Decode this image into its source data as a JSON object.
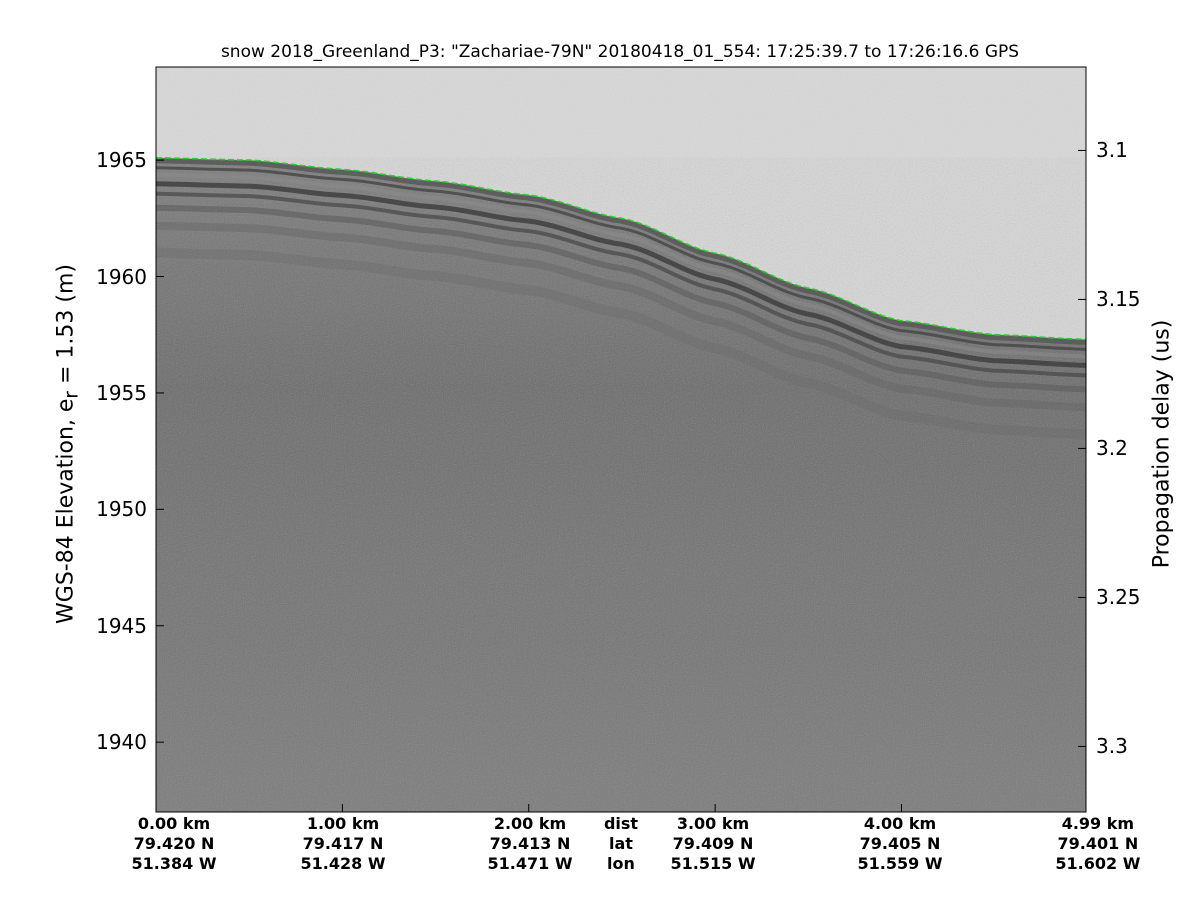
{
  "chart_data": {
    "type": "heatmap",
    "title": "snow 2018_Greenland_P3: \"Zachariae-79N\"  20180418_01_554: 17:25:39.7 to 17:26:16.6 GPS",
    "ylabel_left_prefix": "WGS-84 Elevation, e",
    "ylabel_left_sub": "r",
    "ylabel_left_suffix": " = 1.53 (m)",
    "ylabel_right": "Propagation delay (us)",
    "ylim_left": [
      1937,
      1969
    ],
    "ylim_right": [
      3.072,
      3.322
    ],
    "yticks_left": [
      "1940",
      "1945",
      "1950",
      "1955",
      "1960",
      "1965"
    ],
    "yticks_right": [
      "3.1",
      "3.15",
      "3.2",
      "3.25",
      "3.3"
    ],
    "x_columns": [
      {
        "dist": "0.00 km",
        "lat": "79.420 N",
        "lon": "51.384 W"
      },
      {
        "dist": "1.00 km",
        "lat": "79.417 N",
        "lon": "51.428 W"
      },
      {
        "dist": "2.00 km",
        "lat": "79.413 N",
        "lon": "51.471 W"
      },
      {
        "dist": "3.00 km",
        "lat": "79.409 N",
        "lon": "51.515 W"
      },
      {
        "dist": "4.00 km",
        "lat": "79.405 N",
        "lon": "51.559 W"
      },
      {
        "dist": "4.99 km",
        "lat": "79.401 N",
        "lon": "51.602 W"
      }
    ],
    "x_row_names": {
      "dist": "dist",
      "lat": "lat",
      "lon": "lon"
    },
    "x_distances_km": [
      0,
      1,
      2,
      3,
      4,
      4.99
    ],
    "xlim_km": [
      0,
      4.99
    ],
    "surface_series": {
      "name": "",
      "x_km": [
        0,
        0.5,
        1.0,
        1.5,
        2.0,
        2.5,
        3.0,
        3.5,
        4.0,
        4.5,
        4.99
      ],
      "elevation_m": [
        1965.1,
        1965.0,
        1964.6,
        1964.1,
        1963.5,
        1962.5,
        1961.0,
        1959.5,
        1958.1,
        1957.5,
        1957.3
      ]
    },
    "colors": {
      "surface_line": "#2ecc2e",
      "air": "#d8d8d8",
      "firn": "#707070"
    },
    "grid": false,
    "colormap": "gray"
  }
}
